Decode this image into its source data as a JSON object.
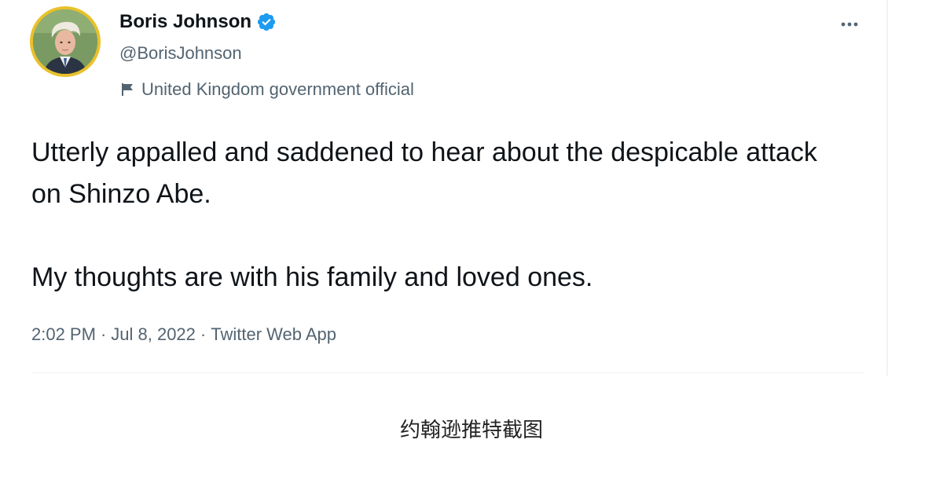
{
  "tweet": {
    "author": {
      "display_name": "Boris Johnson",
      "handle": "@BorisJohnson",
      "label": "United Kingdom government official"
    },
    "text": {
      "paragraph1": "Utterly appalled and saddened to hear about the despicable attack on Shinzo Abe.",
      "paragraph2": "My thoughts are with his family and loved ones."
    },
    "meta": {
      "time": "2:02 PM",
      "separator": "·",
      "date": "Jul 8, 2022",
      "source": "Twitter Web App"
    },
    "icons": {
      "verified": "verified-badge-icon",
      "label": "flag-icon",
      "menu": "more-options-icon"
    },
    "colors": {
      "verified": "#1d9bf0",
      "avatar_ring": "#e9c12b",
      "secondary_text": "#536471",
      "primary_text": "#0f1419"
    }
  },
  "caption": "约翰逊推特截图"
}
